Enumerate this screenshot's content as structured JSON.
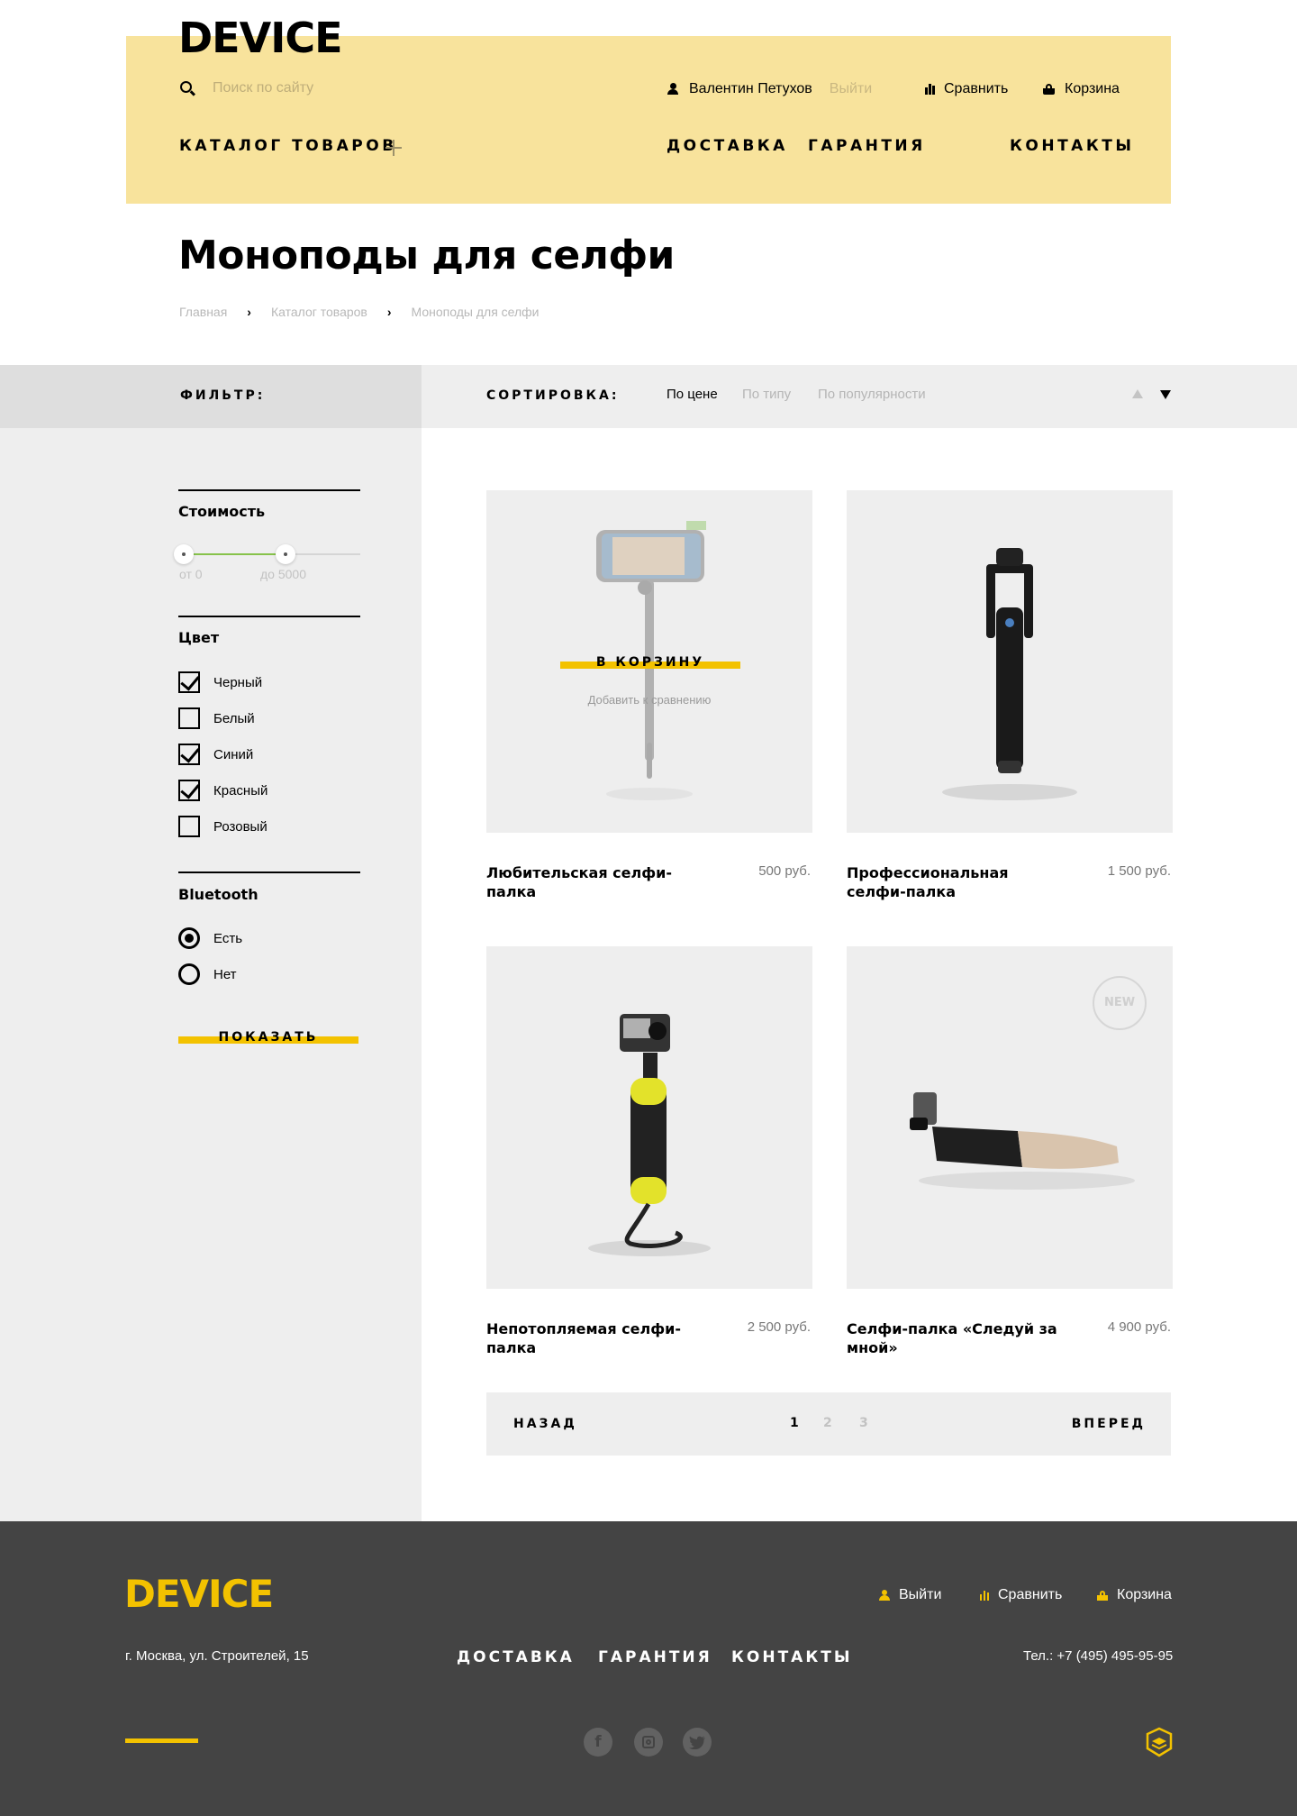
{
  "header": {
    "logo": "DEVICE",
    "search_placeholder": "Поиск по сайту",
    "user_name": "Валентин Петухов",
    "logout": "Выйти",
    "compare": "Сравнить",
    "cart": "Корзина",
    "nav": {
      "catalog": "КАТАЛОГ ТОВАРОВ",
      "delivery": "ДОСТАВКА",
      "warranty": "ГАРАНТИЯ",
      "contacts": "КОНТАКТЫ"
    }
  },
  "page": {
    "title": "Моноподы для селфи",
    "breadcrumb": [
      "Главная",
      "Каталог товаров",
      "Моноподы для селфи"
    ]
  },
  "filter": {
    "label": "ФИЛЬТР:",
    "price": {
      "title": "Стоимость",
      "from": "от 0",
      "to": "до 5000",
      "range": [
        0,
        5000
      ]
    },
    "color": {
      "title": "Цвет",
      "options": [
        {
          "label": "Черный",
          "checked": true
        },
        {
          "label": "Белый",
          "checked": false
        },
        {
          "label": "Синий",
          "checked": true
        },
        {
          "label": "Красный",
          "checked": true
        },
        {
          "label": "Розовый",
          "checked": false
        }
      ]
    },
    "bluetooth": {
      "title": "Bluetooth",
      "options": [
        {
          "label": "Есть",
          "checked": true
        },
        {
          "label": "Нет",
          "checked": false
        }
      ]
    },
    "show_button": "ПОКАЗАТЬ"
  },
  "sort": {
    "label": "СОРТИРОВКА:",
    "options": [
      "По цене",
      "По типу",
      "По популярности"
    ],
    "active": "По цене"
  },
  "products": [
    {
      "name": "Любительская селфи-палка",
      "price": "500 руб.",
      "cart_label": "В КОРЗИНУ",
      "compare_label": "Добавить к сравнению"
    },
    {
      "name": "Профессиональная селфи-палка",
      "price": "1 500 руб."
    },
    {
      "name": "Непотопляемая селфи-палка",
      "price": "2 500 руб."
    },
    {
      "name": "Селфи-палка «Следуй за мной»",
      "price": "4 900 руб.",
      "badge": "NEW"
    }
  ],
  "pagination": {
    "back": "НАЗАД",
    "forward": "ВПЕРЕД",
    "pages": [
      "1",
      "2",
      "3"
    ],
    "current": "1"
  },
  "footer": {
    "logo": "DEVICE",
    "logout": "Выйти",
    "compare": "Сравнить",
    "cart": "Корзина",
    "address": "г. Москва, ул. Строителей, 15",
    "nav": {
      "delivery": "ДОСТАВКА",
      "warranty": "ГАРАНТИЯ",
      "contacts": "КОНТАКТЫ"
    },
    "phone": "Тел.: +7 (495) 495-95-95",
    "social": [
      "facebook-icon",
      "instagram-icon",
      "twitter-icon"
    ]
  },
  "colors": {
    "accent": "#f3c200",
    "header_bg": "#f8e39c",
    "footer_bg": "#444444",
    "panel": "#eeeeee"
  }
}
